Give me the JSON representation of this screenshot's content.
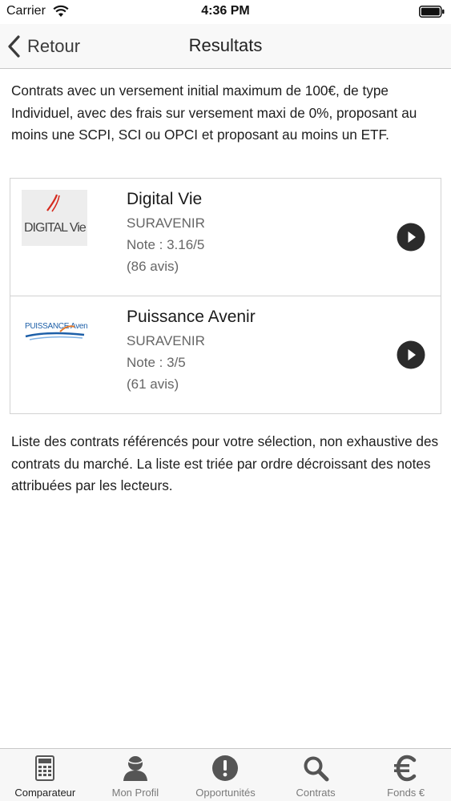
{
  "status_bar": {
    "carrier": "Carrier",
    "time": "4:36 PM"
  },
  "nav": {
    "back_label": "Retour",
    "title": "Resultats"
  },
  "intro_text": "Contrats avec un versement initial maximum de 100€, de type Individuel, avec des frais sur versement maxi de 0%, proposant au moins une SCPI, SCI ou OPCI et proposant au moins un ETF.",
  "results": [
    {
      "name": "Digital Vie",
      "company": "SURAVENIR",
      "note": "Note : 3.16/5",
      "reviews": "(86 avis)",
      "logo_text": "DIGITAL Vie",
      "logo_icon": "digital-vie-logo"
    },
    {
      "name": "Puissance Avenir",
      "company": "SURAVENIR",
      "note": "Note : 3/5",
      "reviews": "(61 avis)",
      "logo_text": "PUISSANCE Avenir",
      "logo_icon": "puissance-avenir-logo"
    }
  ],
  "footnote": "Liste des contrats référencés pour votre sélection, non exhaustive des contrats du marché. La liste est triée par ordre décroissant des notes attribuées par les lecteurs.",
  "tabs": [
    {
      "label": "Comparateur",
      "icon": "calculator-icon",
      "active": true
    },
    {
      "label": "Mon Profil",
      "icon": "user-icon",
      "active": false
    },
    {
      "label": "Opportunités",
      "icon": "exclamation-icon",
      "active": false
    },
    {
      "label": "Contrats",
      "icon": "search-icon",
      "active": false
    },
    {
      "label": "Fonds €",
      "icon": "euro-icon",
      "active": false
    }
  ],
  "colors": {
    "tab_icon": "#555555",
    "play_button": "#2b2b2b",
    "digital_vie_red": "#d62b1f",
    "puissance_blue": "#1d5fa8",
    "puissance_orange": "#e5792b"
  }
}
